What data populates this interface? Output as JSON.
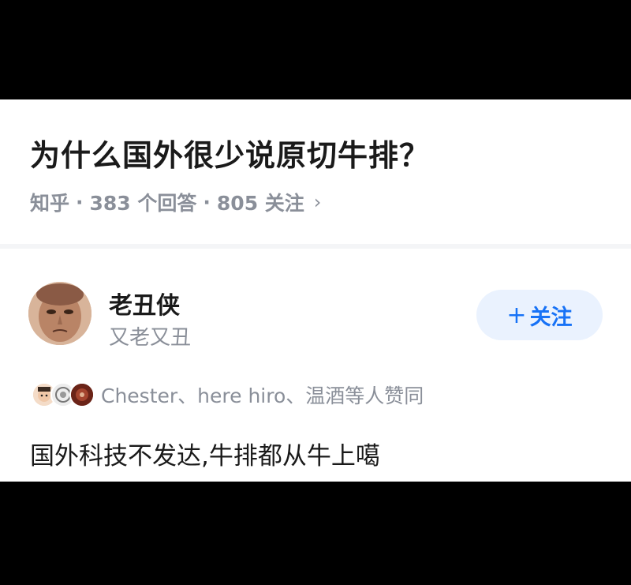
{
  "question": {
    "title": "为什么国外很少说原切牛排？",
    "source": "知乎",
    "answers": "383 个回答",
    "followers": "805 关注",
    "separator": "·",
    "chevron": "›"
  },
  "author": {
    "name": "老丑侠",
    "bio": "又老又丑",
    "avatar_icon": "avatar-icon"
  },
  "follow_button": {
    "plus": "+",
    "label": "关注"
  },
  "upvotes": {
    "text": "Chester、here hiro、温酒等人赞同"
  },
  "answer": {
    "text": "国外科技不发达,牛排都从牛上噶"
  },
  "colors": {
    "accent": "#1772f6",
    "follow_bg": "#eaf2fe",
    "muted": "#8a8f99",
    "text": "#1a1a1a"
  }
}
